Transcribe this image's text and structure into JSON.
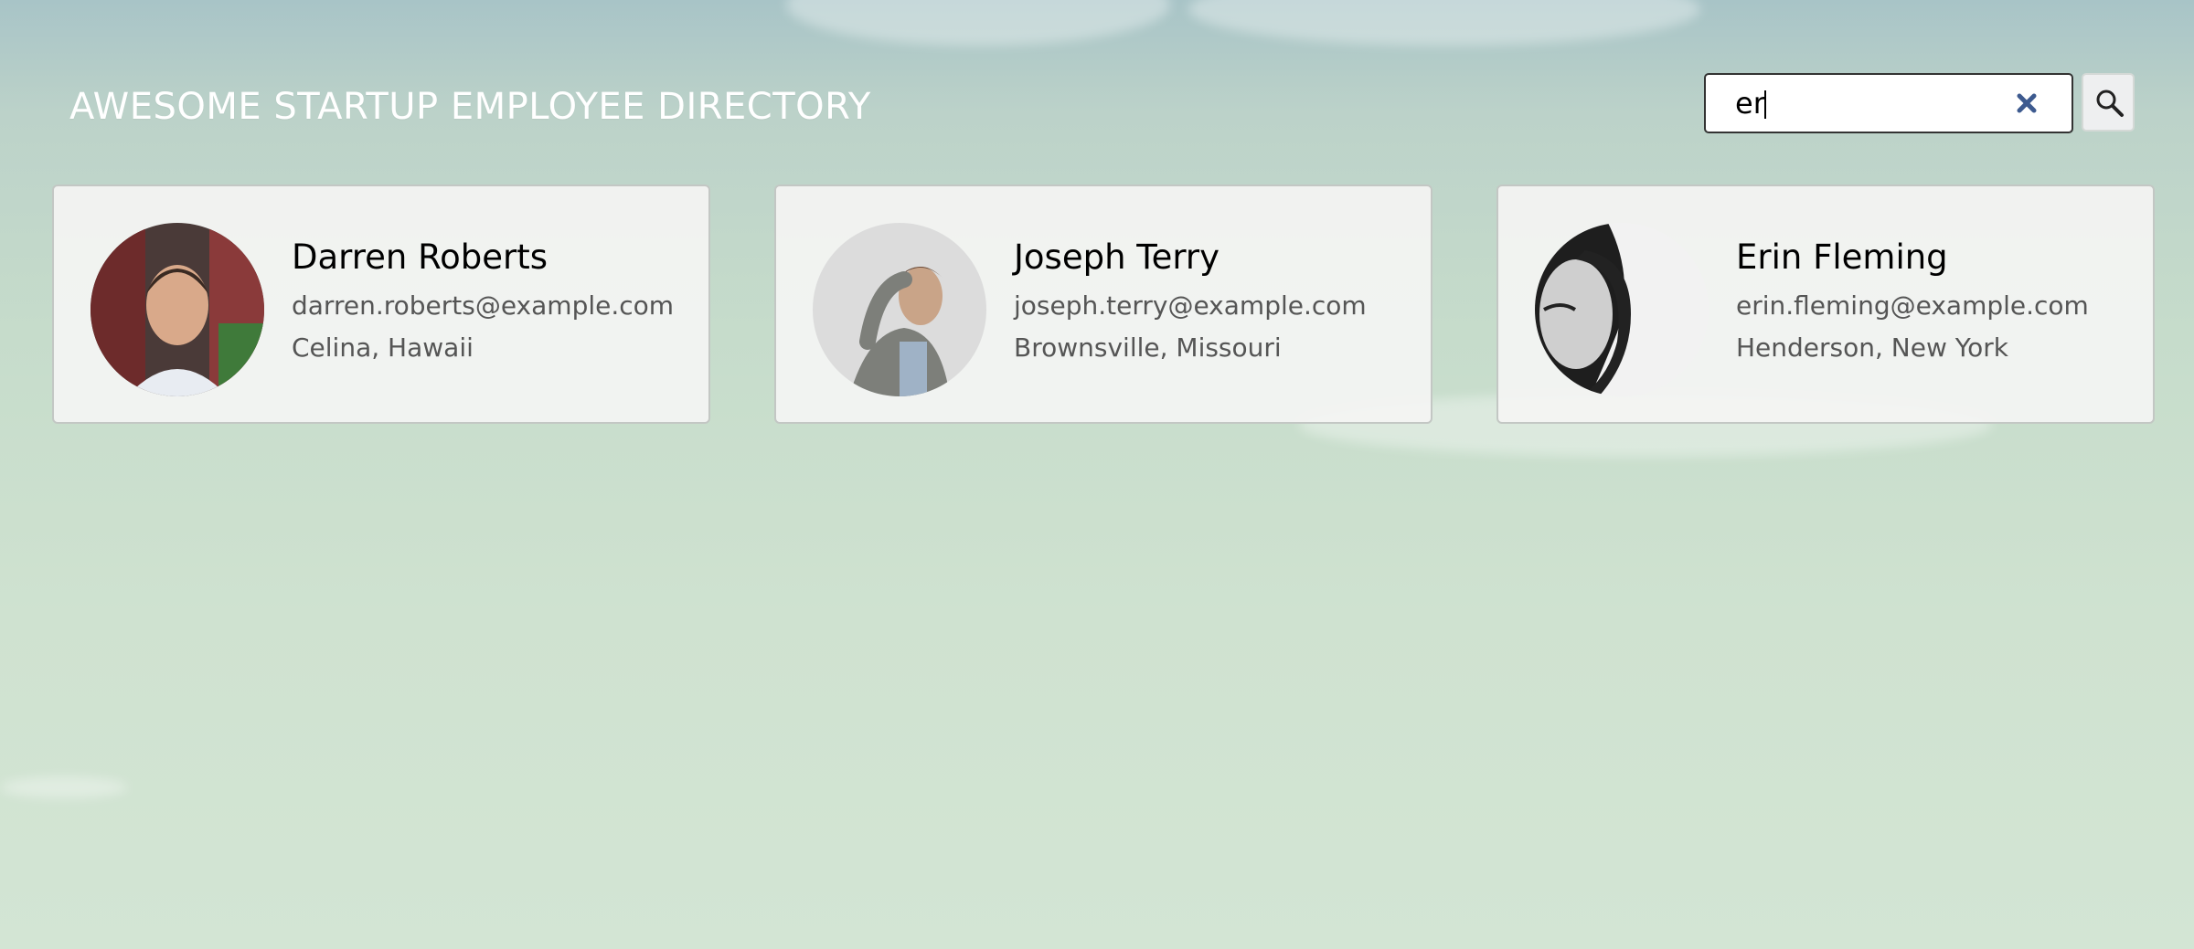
{
  "header": {
    "title": "AWESOME STARTUP EMPLOYEE DIRECTORY"
  },
  "search": {
    "value": "er",
    "clear_icon": "close-icon",
    "submit_icon": "search-icon"
  },
  "employees": [
    {
      "name": "Darren Roberts",
      "email": "darren.roberts@example.com",
      "location": "Celina, Hawaii"
    },
    {
      "name": "Joseph Terry",
      "email": "joseph.terry@example.com",
      "location": "Brownsville, Missouri"
    },
    {
      "name": "Erin Fleming",
      "email": "erin.fleming@example.com",
      "location": "Henderson, New York"
    }
  ],
  "colors": {
    "title": "#ffffff",
    "clear_icon": "#3d5a8f",
    "card_background": "#f4f4f3"
  }
}
